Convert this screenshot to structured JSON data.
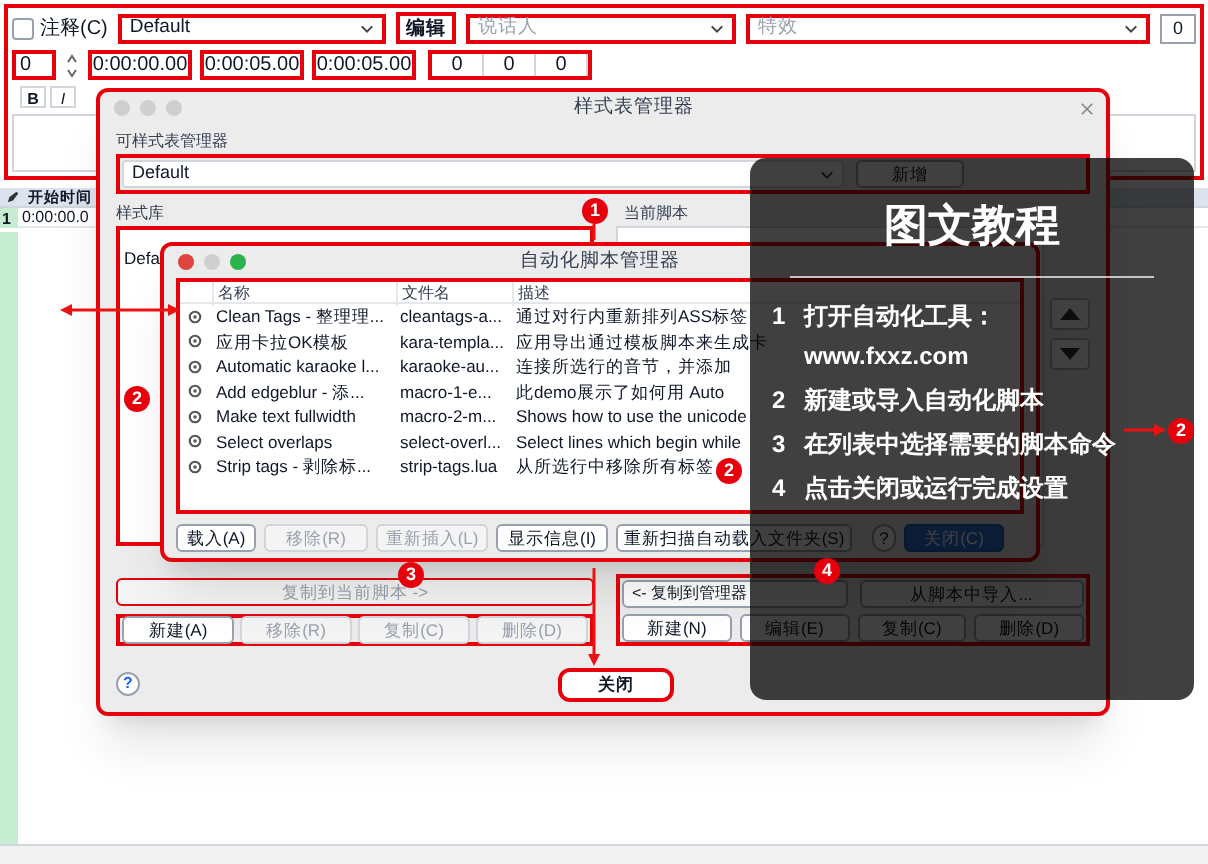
{
  "editor": {
    "comment": {
      "label": "注释(C)",
      "checked": false
    },
    "style": "Default",
    "edit_button": "编辑",
    "actor_placeholder": "说话人",
    "effect_placeholder": "特效",
    "layer_button": "0",
    "layer": "0",
    "times": [
      "0:00:00.00",
      "0:00:05.00",
      "0:00:05.00"
    ],
    "margins": [
      "0",
      "0",
      "0"
    ],
    "format_buttons": [
      "B",
      "I"
    ],
    "grid": {
      "column": "开始时间",
      "rows": [
        {
          "number": "1",
          "start": "0:00:00.0"
        }
      ]
    }
  },
  "style_manager": {
    "title": "样式表管理器",
    "catalog_label": "可样式表管理器",
    "catalog": "Default",
    "catalog_buttons": [
      {
        "label": "新增",
        "disabled": false
      }
    ],
    "storage": {
      "label": "样式库",
      "items": [
        "Defa"
      ],
      "copy_button": {
        "label": "复制到当前脚本 ->",
        "disabled": true
      },
      "buttons": [
        {
          "label": "新建(A)",
          "disabled": false
        },
        {
          "label": "移除(R)",
          "disabled": true
        },
        {
          "label": "复制(C)",
          "disabled": true
        },
        {
          "label": "删除(D)",
          "disabled": true
        }
      ]
    },
    "current": {
      "label": "当前脚本",
      "copy_button": {
        "label": "<- 复制到管理器",
        "disabled": false
      },
      "import_button": "从脚本中导入...",
      "buttons": [
        {
          "label": "新建(N)",
          "disabled": false
        },
        {
          "label": "编辑(E)",
          "disabled": false
        },
        {
          "label": "复制(C)",
          "disabled": false
        },
        {
          "label": "删除(D)",
          "disabled": false
        }
      ]
    },
    "help": "?",
    "close_buttons": [
      {
        "label": "关闭",
        "disabled": false
      }
    ]
  },
  "automation_manager": {
    "title": "自动化脚本管理器",
    "columns": [
      "名称",
      "文件名",
      "描述"
    ],
    "rows": [
      {
        "name": "Clean Tags - 整理理...",
        "file": "cleantags-a...",
        "description": "通过对行内重新排列ASS标签"
      },
      {
        "name": "应用卡拉OK模板",
        "file": "kara-templa...",
        "description": "应用导出通过模板脚本来生成卡"
      },
      {
        "name": "Automatic karaoke l...",
        "file": "karaoke-au...",
        "description": "连接所选行的音节，并添加"
      },
      {
        "name": "Add edgeblur - 添...",
        "file": "macro-1-e...",
        "description": "此demo展示了如何用 Auto"
      },
      {
        "name": "Make text fullwidth",
        "file": "macro-2-m...",
        "description": "Shows how to use the unicode"
      },
      {
        "name": "Select overlaps",
        "file": "select-overl...",
        "description": "Select lines which begin while"
      },
      {
        "name": "Strip tags - 剥除标...",
        "file": "strip-tags.lua",
        "description": "从所选行中移除所有标签"
      }
    ],
    "buttons": [
      {
        "label": "载入(A)",
        "disabled": false,
        "default": false
      },
      {
        "label": "移除(R)",
        "disabled": true,
        "default": false
      },
      {
        "label": "重新插入(L)",
        "disabled": true,
        "default": false
      },
      {
        "label": "显示信息(I)",
        "disabled": false,
        "default": false
      },
      {
        "label": "重新扫描自动载入文件夹(S)",
        "disabled": false,
        "default": false
      },
      {
        "label": "?",
        "disabled": false,
        "default": false
      },
      {
        "label": "关闭(C)",
        "disabled": false,
        "default": true
      }
    ]
  },
  "tutorial": {
    "title": "图文教程",
    "steps": [
      {
        "number": "1",
        "lines": [
          "打开自动化工具：",
          "www.fxxz.com"
        ]
      },
      {
        "number": "2",
        "lines": [
          "新建或导入自动化脚本"
        ]
      },
      {
        "number": "3",
        "lines": [
          "在列表中选择需要的脚本命令"
        ]
      },
      {
        "number": "4",
        "lines": [
          "点击关闭或运行完成设置"
        ]
      }
    ]
  },
  "badges": [
    "1",
    "2",
    "2",
    "2",
    "3",
    "4"
  ]
}
